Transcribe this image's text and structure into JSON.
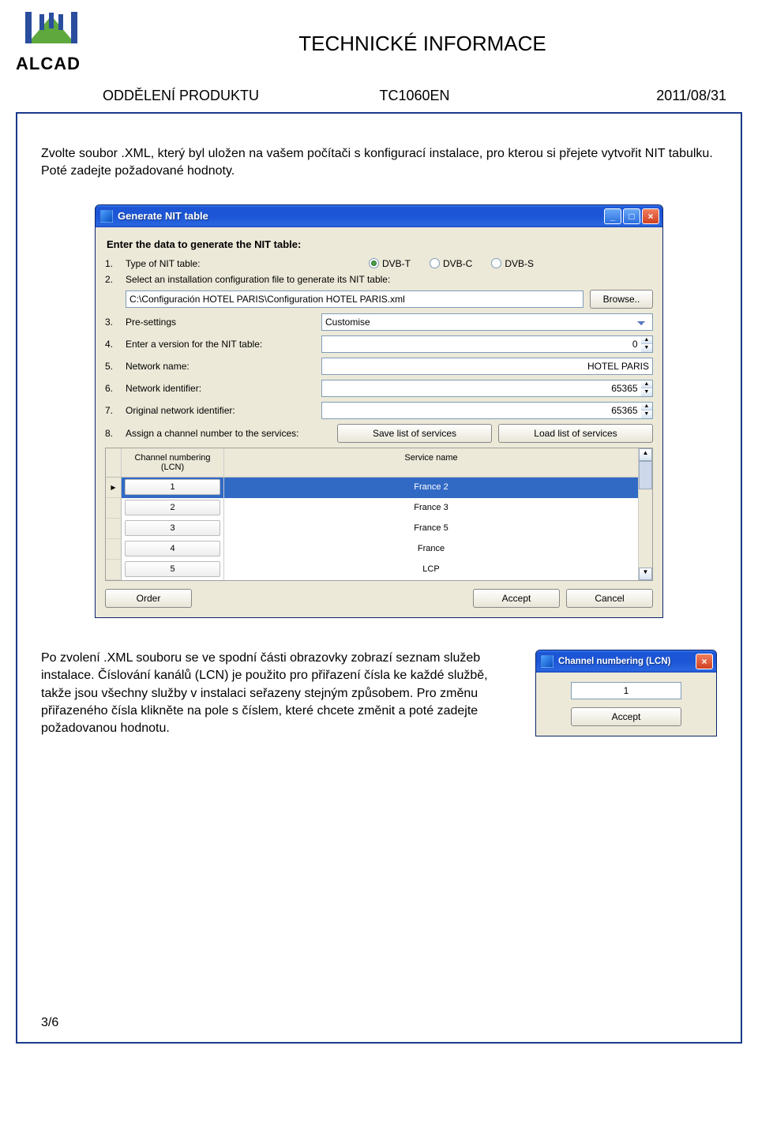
{
  "header": {
    "doc_title": "TECHNICKÉ INFORMACE",
    "dept": "ODDĚLENÍ PRODUKTU",
    "code": "TC1060EN",
    "date": "2011/08/31",
    "logo_text": "ALCAD"
  },
  "intro": "Zvolte soubor .XML, který byl uložen na vašem počítači s konfigurací instalace, pro kterou si přejete vytvořit NIT tabulku. Poté zadejte požadované hodnoty.",
  "window": {
    "title": "Generate NIT table",
    "heading": "Enter the data to generate the NIT table:",
    "rows": {
      "r1": {
        "num": "1.",
        "label": "Type of NIT table:",
        "opt1": "DVB-T",
        "opt2": "DVB-C",
        "opt3": "DVB-S"
      },
      "r2": {
        "num": "2.",
        "label": "Select an installation configuration file to generate its NIT table:",
        "value": "C:\\Configuración HOTEL PARIS\\Configuration HOTEL PARIS.xml",
        "browse": "Browse.."
      },
      "r3": {
        "num": "3.",
        "label": "Pre-settings",
        "value": "Customise"
      },
      "r4": {
        "num": "4.",
        "label": "Enter a version for the NIT table:",
        "value": "0"
      },
      "r5": {
        "num": "5.",
        "label": "Network name:",
        "value": "HOTEL PARIS"
      },
      "r6": {
        "num": "6.",
        "label": "Network identifier:",
        "value": "65365"
      },
      "r7": {
        "num": "7.",
        "label": "Original network identifier:",
        "value": "65365"
      },
      "r8": {
        "num": "8.",
        "label": "Assign a channel number to the services:",
        "save": "Save list of services",
        "load": "Load list of services"
      }
    },
    "table": {
      "head_lcn": "Channel numbering (LCN)",
      "head_name": "Service name",
      "rows": [
        {
          "lcn": "1",
          "name": "France 2"
        },
        {
          "lcn": "2",
          "name": "France 3"
        },
        {
          "lcn": "3",
          "name": "France 5"
        },
        {
          "lcn": "4",
          "name": "France"
        },
        {
          "lcn": "5",
          "name": "LCP"
        }
      ]
    },
    "footer": {
      "order": "Order",
      "accept": "Accept",
      "cancel": "Cancel"
    }
  },
  "bottom_text": "Po zvolení .XML souboru se ve spodní části obrazovky zobrazí seznam služeb instalace. Číslování kanálů (LCN) je použito pro přiřazení čísla ke každé službě, takže jsou všechny služby v instalaci seřazeny stejným způsobem. Pro změnu přiřazeného čísla klikněte na pole s číslem, které chcete změnit a poté zadejte požadovanou hodnotu.",
  "mini": {
    "title": "Channel numbering (LCN)",
    "value": "1",
    "accept": "Accept"
  },
  "page_num": "3/6"
}
